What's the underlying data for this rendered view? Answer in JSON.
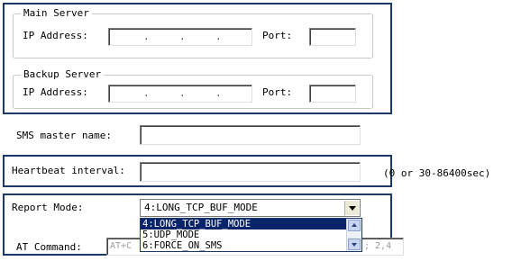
{
  "main_server": {
    "legend": "Main Server",
    "ip_label": "IP Address:",
    "port_label": "Port:",
    "ip_value": "",
    "port_value": ""
  },
  "backup_server": {
    "legend": "Backup Server",
    "ip_label": "IP Address:",
    "port_label": "Port:",
    "ip_value": "",
    "port_value": ""
  },
  "sms_master": {
    "label": "SMS master name:",
    "value": ""
  },
  "heartbeat": {
    "label": "Heartbeat interval:",
    "value": "",
    "hint": "(0 or 30-86400sec)"
  },
  "report_mode": {
    "label": "Report Mode:",
    "selected": "4:LONG_TCP_BUF_MODE",
    "options": [
      "4:LONG_TCP_BUF_MODE",
      "5:UDP_MODE",
      "6:FORCE_ON_SMS"
    ],
    "highlighted_index": 0
  },
  "at_command": {
    "label": "AT Command:",
    "value_fragment": "AT+C",
    "value_tail": "; 2,4"
  },
  "icons": {
    "dropdown_arrow": "chevron-down-icon",
    "scroll_up": "scroll-up-icon",
    "scroll_down": "scroll-down-icon"
  }
}
